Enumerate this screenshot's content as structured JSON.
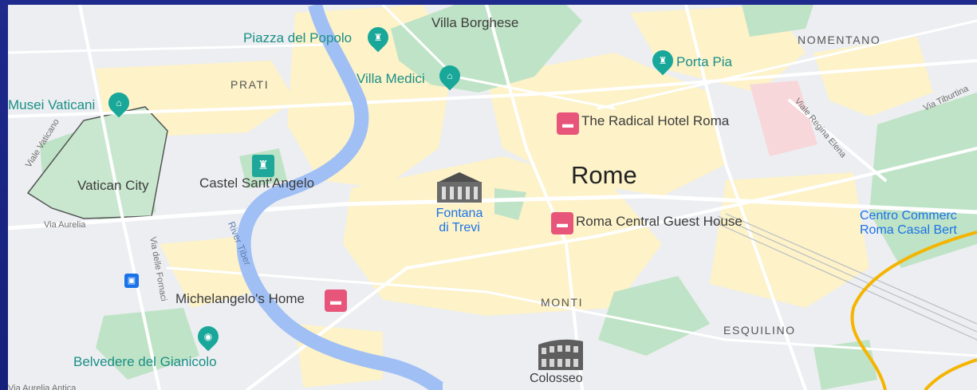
{
  "map": {
    "city": "Rome",
    "districts": {
      "prati": "PRATI",
      "nomentano": "NOMENTANO",
      "monti": "MONTI",
      "esquilino": "ESQUILINO"
    },
    "places": {
      "piazza_popolo": "Piazza del Popolo",
      "villa_borghese": "Villa Borghese",
      "villa_medici": "Villa Medici",
      "porta_pia": "Porta Pia",
      "musei_vaticani": "Musei Vaticani",
      "radical_hotel": "The Radical Hotel Roma",
      "vatican_city": "Vatican City",
      "castel_santangelo": "Castel Sant'Angelo",
      "fontana_trevi_l1": "Fontana",
      "fontana_trevi_l2": "di Trevi",
      "roma_central": "Roma Central Guest House",
      "centro_commerciale_l1": "Centro Commerc",
      "centro_commerciale_l2": "Roma Casal Bert",
      "michelangelo_home": "Michelangelo's Home",
      "belvedere": "Belvedere del Gianicolo",
      "colosseo": "Colosseo"
    },
    "streets": {
      "viale_vaticano": "Viale Vaticano",
      "via_aurelia": "Via Aurelia",
      "via_delle_fornaci": "Via delle Fornaci",
      "river_tiber": "River Tiber",
      "viale_regina_elena": "Viale Regina Elena",
      "via_tiburtina": "Via Tiburtina",
      "via_aurelia_antica": "Via Aurelia Antica"
    },
    "colors": {
      "park": "#bfe3c6",
      "water": "#9fbff5",
      "built": "#fdf2c8",
      "road": "#ffffff",
      "highway": "#f4b400",
      "hotel": "#e8557a",
      "attraction": "#1fa89a"
    }
  }
}
